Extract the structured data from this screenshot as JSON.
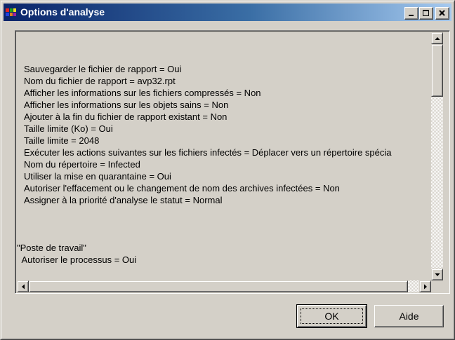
{
  "window": {
    "title": "Options d'analyse",
    "controls": {
      "minimize_icon": "minimize-icon",
      "maximize_icon": "maximize-icon",
      "close_icon": "close-icon"
    }
  },
  "report": {
    "lines": [
      "Sauvegarder le fichier de rapport = Oui",
      "Nom du fichier de rapport = avp32.rpt",
      "Afficher les informations sur les fichiers compressés = Non",
      "Afficher les informations sur les objets sains = Non",
      "Ajouter à la fin du fichier de rapport existant = Non",
      "Taille limite (Ko) = Oui",
      "Taille limite = 2048",
      "Exécuter les actions suivantes sur les fichiers infectés = Déplacer vers un répertoire spécia",
      "Nom du répertoire = Infected",
      "Utiliser la mise en quarantaine = Oui",
      "Autoriser l'effacement ou le changement de nom des archives infectées = Non",
      "Assigner à la priorité d'analyse le statut = Normal",
      "\"Poste de travail\"",
      "  Autoriser le processus = Oui"
    ]
  },
  "buttons": {
    "ok_label": "OK",
    "help_label": "Aide"
  },
  "colors": {
    "face": "#d4d0c8",
    "title_start": "#0a246a",
    "title_end": "#a6caf0"
  }
}
